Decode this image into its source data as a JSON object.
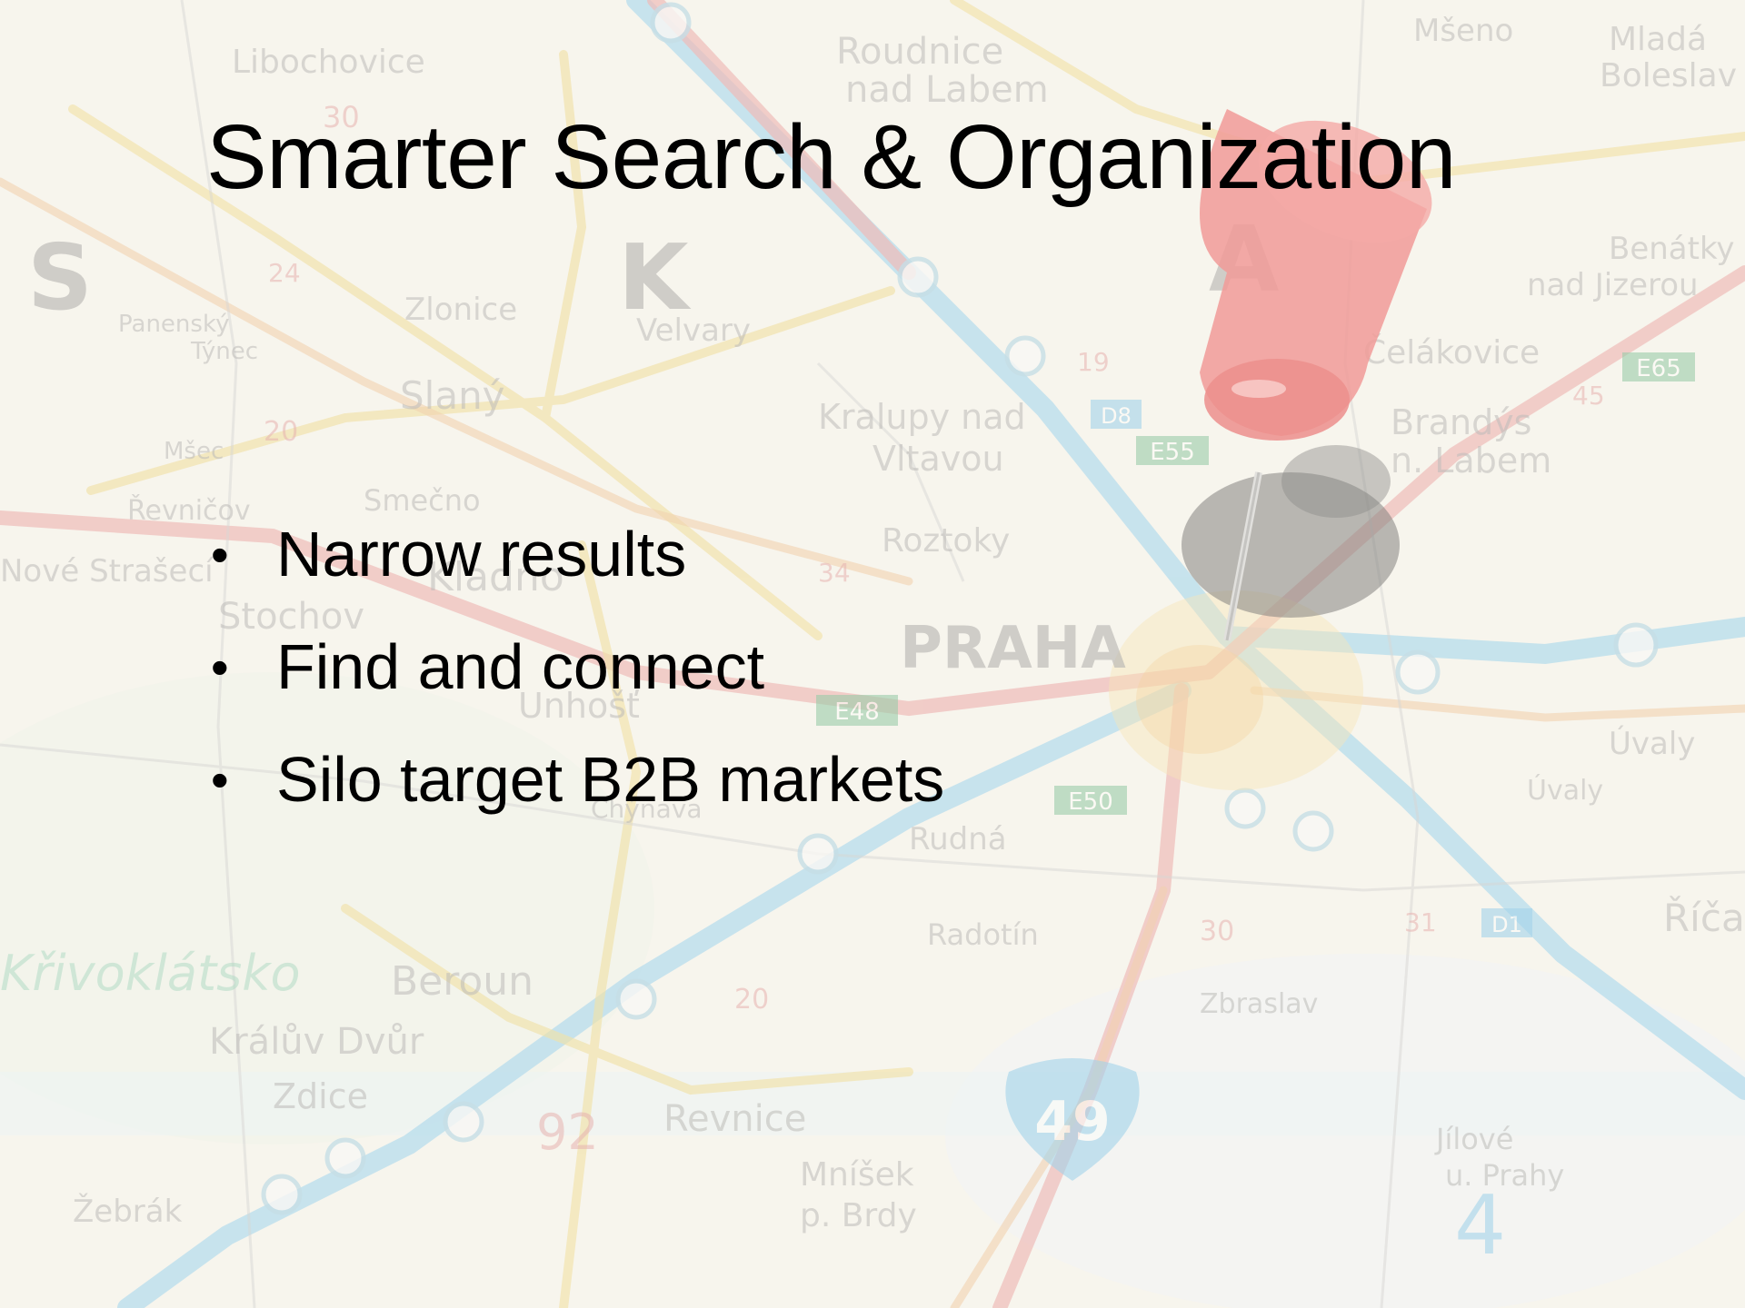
{
  "slide": {
    "title": "Smarter Search & Organization",
    "bullets": [
      "Narrow results",
      "Find and connect",
      "Silo target B2B markets"
    ]
  },
  "background": {
    "description_icon": "map-with-pushpin",
    "map_labels": [
      "Roudnice nad Labem",
      "Libochovice",
      "Mšeno",
      "Mladá Boleslav",
      "Zlonice",
      "Panenský Týnec",
      "Velvary",
      "Slaný",
      "Kralupy nad Vltavou",
      "Benátky nad Jizerou",
      "Čelákovice",
      "Brandýs nad Labem",
      "Roztoky",
      "Smečno",
      "Kladno",
      "Stochov",
      "Nové Strašecí",
      "PRAHA",
      "Unhošť",
      "Rudná",
      "Úvaly",
      "Úvaly",
      "Radotín",
      "Beroun",
      "Králův Dvůr",
      "Zdice",
      "Revnice",
      "Mníšek p. Brdy",
      "Zbraslav",
      "Jílové u. Prahy",
      "Říčany",
      "Žebrák",
      "Křivoklátsko"
    ],
    "road_numbers": [
      "49",
      "92",
      "4",
      "E50",
      "E48",
      "E55",
      "E65",
      "D8",
      "D1"
    ],
    "colors": {
      "background": "#f4f1ea",
      "highway": "#6ab8e0",
      "main_road": "#e08080",
      "secondary_road": "#e6c860",
      "pin": "#e03a3a"
    }
  }
}
